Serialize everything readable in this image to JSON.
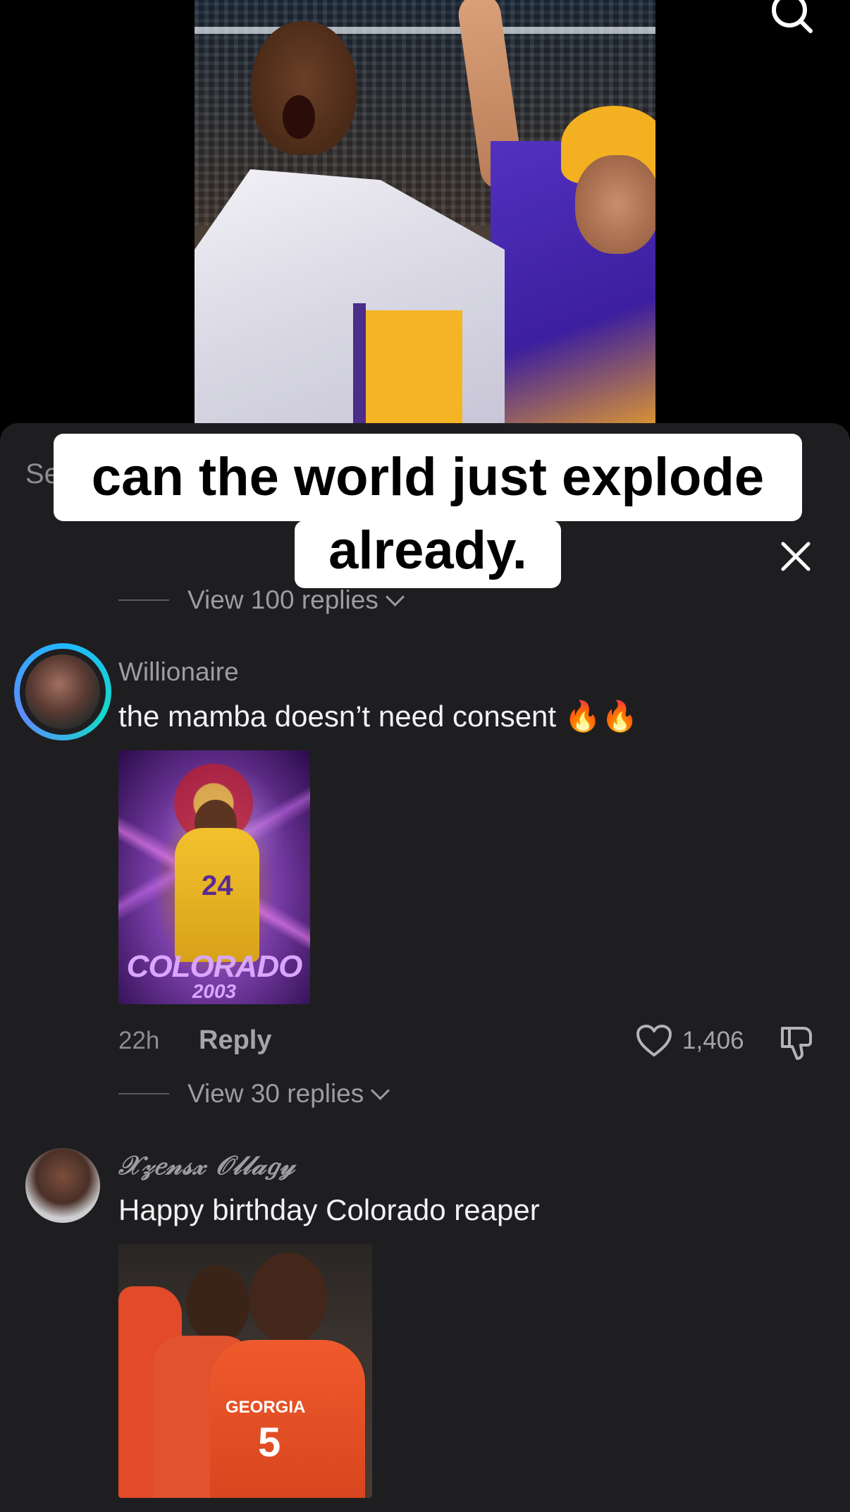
{
  "video": {
    "overlay_caption_line1": "can the world just explode",
    "overlay_caption_line2": "already."
  },
  "sheet": {
    "header_partial": "Se",
    "view_more_replies_top": "View 100 replies"
  },
  "comments": [
    {
      "username": "Willionaire",
      "text": "the mamba doesn’t need consent 🔥🔥",
      "image_overlay_text": "COLORADO",
      "image_overlay_sub": "2003",
      "image_jersey_number": "24",
      "timestamp": "22h",
      "reply_label": "Reply",
      "like_count": "1,406",
      "view_replies": "View 30 replies"
    },
    {
      "username": "𝒳𝓏𝑒𝓃𝓈𝓍 𝒪𝓁𝓁𝒶𝑔𝓎",
      "text": "Happy birthday Colorado reaper",
      "image_team_text": "GEORGIA",
      "image_jersey_number": "5"
    }
  ],
  "colors": {
    "sheet_bg": "#1e1e20",
    "text_primary": "#f2f2f4",
    "text_secondary": "#9c9ca1",
    "avatar_ring": "#14d9c9"
  }
}
